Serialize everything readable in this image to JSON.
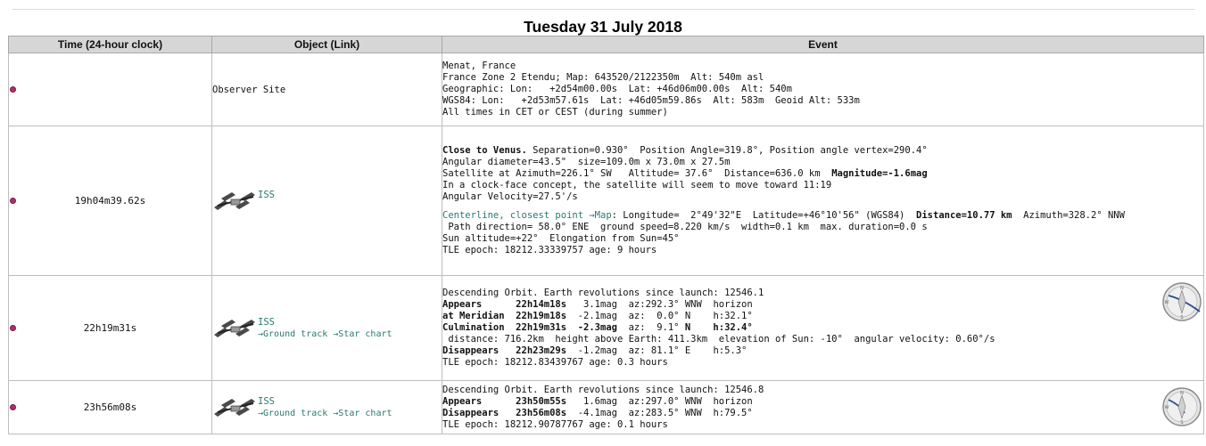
{
  "day_title": "Tuesday 31 July 2018",
  "columns": {
    "time": "Time (24-hour clock)",
    "object": "Object (Link)",
    "event": "Event"
  },
  "rows": [
    {
      "time": "",
      "object": "Observer Site",
      "lines": [
        [
          {
            "t": "Menat, France"
          }
        ],
        [
          {
            "t": "France Zone 2 Etendu; Map: 643520/2122350m  Alt: 540m asl"
          }
        ],
        [
          {
            "t": "Geographic: Lon:   +2d54m00.00s  Lat: +46d06m00.00s  Alt: 540m"
          }
        ],
        [
          {
            "t": "WGS84: Lon:   +2d53m57.61s  Lat: +46d05m59.86s  Alt: 583m  Geoid Alt: 533m"
          }
        ],
        [
          {
            "t": "All times in CET or CEST (during summer)"
          }
        ]
      ]
    },
    {
      "time": "19h04m39.62s",
      "object": "ISS",
      "lines": [
        [
          {
            "t": "Close to Venus.",
            "b": true
          },
          {
            "t": " Separation=0.930°  Position Angle=319.8°, Position angle vertex=290.4°"
          }
        ],
        [
          {
            "t": "Angular diameter=43.5\"  size=109.0m x 73.0m x 27.5m"
          }
        ],
        [
          {
            "t": "Satellite at Azimuth=226.1° SW   Altitude= 37.6°  Distance=636.0 km  "
          },
          {
            "t": "Magnitude=-1.6mag",
            "b": true
          }
        ],
        [
          {
            "t": "In a clock-face concept, the satellite will seem to move toward 11:19"
          }
        ],
        [
          {
            "t": "Angular Velocity=27.5'/s"
          }
        ],
        [],
        [
          {
            "t": "Centerline, closest point →Map",
            "c": "teal"
          },
          {
            "t": ": Longitude=  2°49'32\"E  Latitude=+46°10'56\" (WGS84)  "
          },
          {
            "t": "Distance=10.77 km",
            "b": true
          },
          {
            "t": "  Azimuth=328.2° NNW"
          }
        ],
        [
          {
            "t": " Path direction= 58.0° ENE  ground speed=8.220 km/s  width=0.1 km  max. duration=0.0 s"
          }
        ],
        [
          {
            "t": "Sun altitude=+22°  Elongation from Sun=45°"
          }
        ],
        [
          {
            "t": "TLE epoch: 18212.33339757 age: 9 hours"
          }
        ]
      ]
    },
    {
      "time": "22h19m31s",
      "object": "ISS",
      "links": "→Ground track →Star chart",
      "lines": [
        [
          {
            "t": "Descending Orbit. Earth revolutions since launch: 12546.1"
          }
        ],
        [
          {
            "t": "Appears      22h14m18s",
            "b": true
          },
          {
            "t": "   3.1mag  az:292.3° WNW  horizon"
          }
        ],
        [
          {
            "t": "at Meridian  22h19m18s",
            "b": true
          },
          {
            "t": "  -2.1mag  az:  0.0° N    h:32.1°"
          }
        ],
        [
          {
            "t": "Culmination  22h19m31s  -2.3mag",
            "b": true
          },
          {
            "t": "  az:  9.1° "
          },
          {
            "t": "N    h:32.4°",
            "b": true
          }
        ],
        [
          {
            "t": " distance: 716.2km  height above Earth: 411.3km  elevation of Sun: -10°  angular velocity: 0.60°/s"
          }
        ],
        [
          {
            "t": "Disappears   22h23m29s",
            "b": true
          },
          {
            "t": "  -1.2mag  az: 81.1° E    h:5.3°"
          }
        ],
        [
          {
            "t": "TLE epoch: 18212.83439767 age: 0.3 hours"
          }
        ]
      ]
    },
    {
      "time": "23h56m08s",
      "object": "ISS",
      "links": "→Ground track →Star chart",
      "lines": [
        [
          {
            "t": "Descending Orbit. Earth revolutions since launch: 12546.8"
          }
        ],
        [
          {
            "t": "Appears      23h50m55s",
            "b": true
          },
          {
            "t": "   1.6mag  az:297.0° WNW  horizon"
          }
        ],
        [
          {
            "t": "Disappears   23h56m08s",
            "b": true
          },
          {
            "t": "  -4.1mag  az:283.5° WNW  h:79.5°"
          }
        ],
        [
          {
            "t": "TLE epoch: 18212.90787767 age: 0.1 hours"
          }
        ]
      ]
    }
  ],
  "colors": {
    "link": "#2a7a6e",
    "header_bg": "#d6d6d6",
    "marker": "#b0306a"
  }
}
